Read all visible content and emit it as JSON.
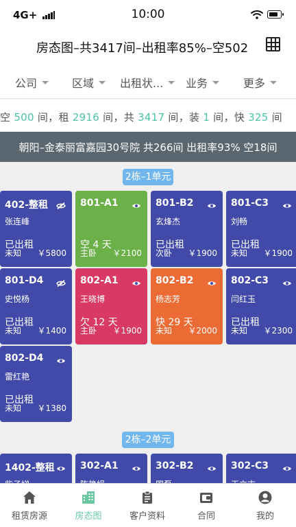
{
  "status_bar": {
    "carrier": "4G+",
    "time": "10:00"
  },
  "header": {
    "title": "房态图–共3417间–出租率85%–空502"
  },
  "filters": [
    {
      "label": "公司"
    },
    {
      "label": "区域"
    },
    {
      "label": "出租状..."
    },
    {
      "label": "业务"
    },
    {
      "label": "更多"
    }
  ],
  "summary": {
    "vacant_label": "空",
    "vacant": "500",
    "unit1": "间，租",
    "rented": "2916",
    "unit2": "间，共",
    "total": "3417",
    "unit3": "间，装",
    "renovating": "1",
    "unit4": "间，快",
    "expiring": "325",
    "unit5": "间"
  },
  "complex": {
    "text": "朝阳–金泰丽富嘉园30号院 共266间 出租率93% 空18间"
  },
  "units": [
    {
      "label": "2栋–1单元",
      "rooms": [
        {
          "no": "402-整租",
          "tenant": "张连峰",
          "state": "已出租",
          "type": "未知",
          "price": "￥5800",
          "color": "blue",
          "eye": "closed"
        },
        {
          "no": "801-A1",
          "tenant": "",
          "state": "空 4 天",
          "type": "主卧",
          "price": "￥2100",
          "color": "green",
          "eye": "open"
        },
        {
          "no": "801-B2",
          "tenant": "玄烽杰",
          "state": "已出租",
          "type": "次卧",
          "price": "￥1900",
          "color": "blue",
          "eye": "open"
        },
        {
          "no": "801-C3",
          "tenant": "刘畅",
          "state": "已出租",
          "type": "未知",
          "price": "￥1900",
          "color": "blue",
          "eye": "open"
        },
        {
          "no": "801-D4",
          "tenant": "史悦杨",
          "state": "已出租",
          "type": "未知",
          "price": "￥1400",
          "color": "blue",
          "eye": "closed"
        },
        {
          "no": "802-A1",
          "tenant": "王晓博",
          "state": "欠 12 天",
          "type": "主卧",
          "price": "￥1900",
          "color": "red",
          "eye": "open"
        },
        {
          "no": "802-B2",
          "tenant": "杨志芳",
          "state": "快 29 天",
          "type": "未知",
          "price": "￥2000",
          "color": "orange",
          "eye": "open"
        },
        {
          "no": "802-C3",
          "tenant": "闫红玉",
          "state": "已出租",
          "type": "未知",
          "price": "￥2300",
          "color": "blue",
          "eye": "open"
        },
        {
          "no": "802-D4",
          "tenant": "雷红艳",
          "state": "已出租",
          "type": "未知",
          "price": "￥1380",
          "color": "blue",
          "eye": "open"
        }
      ]
    },
    {
      "label": "2栋–2单元",
      "rooms": [
        {
          "no": "1402-整租",
          "tenant": "柴子娣",
          "color": "blue",
          "eye": "open"
        },
        {
          "no": "302-A1",
          "tenant": "陈艳娟",
          "color": "blue",
          "eye": "open"
        },
        {
          "no": "302-B2",
          "tenant": "国磊",
          "color": "blue",
          "eye": "open"
        },
        {
          "no": "302-C3",
          "tenant": "王立志",
          "color": "blue",
          "eye": "open"
        }
      ]
    }
  ],
  "tabs": [
    {
      "label": "租赁房源",
      "icon": "home-icon"
    },
    {
      "label": "房态图",
      "icon": "building-icon",
      "active": true
    },
    {
      "label": "客户资料",
      "icon": "clipboard-icon"
    },
    {
      "label": "合同",
      "icon": "wallet-icon"
    },
    {
      "label": "我的",
      "icon": "user-icon"
    }
  ],
  "colors": {
    "accent": "#6cc8a4",
    "rented": "#414aa8",
    "vacant": "#6bb048",
    "arrears": "#d83a63",
    "expiring": "#ec6b34",
    "unit_label": "#71b7ee",
    "complex_bar": "#5b6770"
  }
}
